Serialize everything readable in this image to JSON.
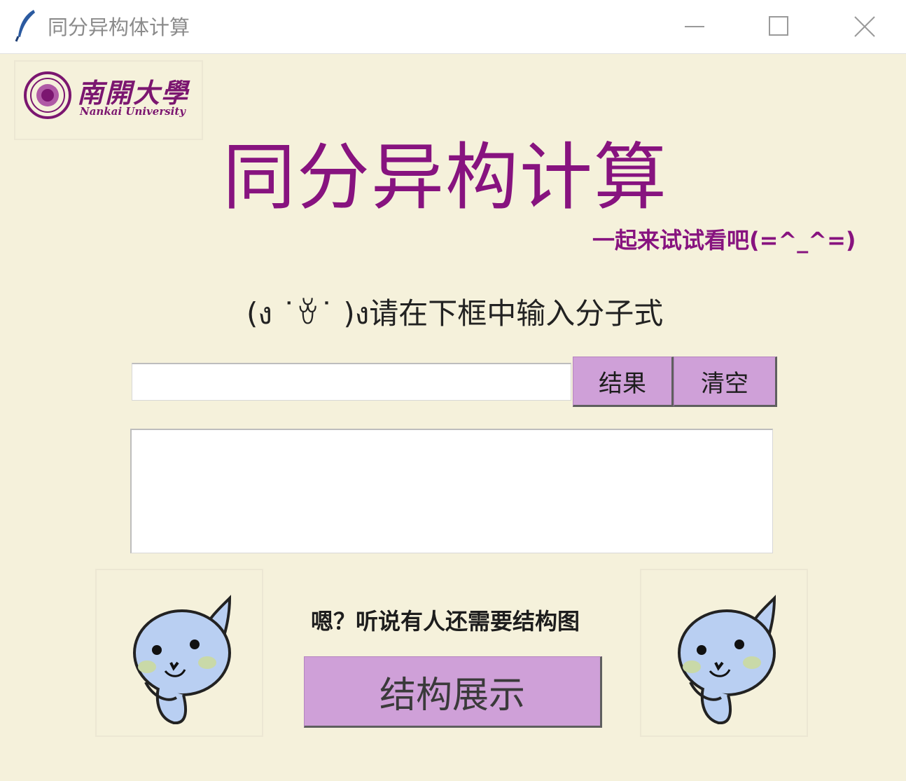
{
  "window": {
    "title": "同分异构体计算"
  },
  "logo": {
    "name_cn": "南開大學",
    "name_en": "Nankai University"
  },
  "main": {
    "title": "同分异构计算",
    "subtitle": "一起来试试看吧(=^_^=)",
    "prompt": "(ง ˙ꈊ˙ )ง请在下框中输入分子式",
    "formula_input": {
      "value": "",
      "placeholder": ""
    },
    "result_button": "结果",
    "clear_button": "清空",
    "output_text": "",
    "hint": "嗯？听说有人还需要结构图",
    "structure_button": "结构展示"
  },
  "colors": {
    "background": "#f5f1db",
    "accent_purple": "#87137f",
    "button_fill": "#cfa0d8",
    "mascot_fill": "#b9cff2"
  },
  "icons": {
    "app": "feather-icon",
    "minimize": "minimize-icon",
    "maximize": "maximize-icon",
    "close": "close-icon",
    "mascots": [
      "cat-mascot",
      "cat-mascot"
    ]
  }
}
